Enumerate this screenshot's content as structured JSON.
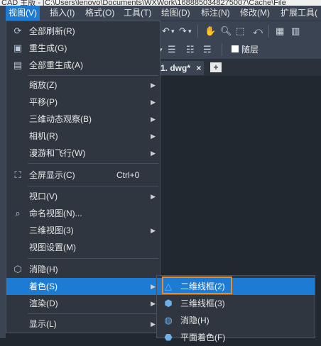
{
  "titlebar": {
    "path": "CAD 主版 - [C:\\Users\\lenovo\\Documents\\WXWork\\1688850348275007\\Cache\\File"
  },
  "menubar": {
    "items": [
      {
        "label": "视图(V)",
        "active": true
      },
      {
        "label": "插入(I)"
      },
      {
        "label": "格式(O)"
      },
      {
        "label": "工具(T)"
      },
      {
        "label": "绘图(D)"
      },
      {
        "label": "标注(N)"
      },
      {
        "label": "修改(M)"
      },
      {
        "label": "扩展工具("
      }
    ]
  },
  "toolbar": {
    "layer_label": "随层"
  },
  "doc_tab": {
    "label": "1. dwg*",
    "close": "×"
  },
  "view_menu": {
    "items": [
      {
        "label": "全部刷新(R)",
        "icon": "refresh-icon"
      },
      {
        "label": "重生成(G)",
        "icon": "regen-icon"
      },
      {
        "label": "全部重生成(A)",
        "icon": "regen-all-icon"
      },
      {
        "label": "缩放(Z)",
        "submenu": true
      },
      {
        "label": "平移(P)",
        "submenu": true
      },
      {
        "label": "三维动态观察(B)",
        "submenu": true
      },
      {
        "label": "相机(R)",
        "submenu": true
      },
      {
        "label": "漫游和飞行(W)",
        "submenu": true
      },
      {
        "label": "全屏显示(C)",
        "icon": "fullscreen-icon",
        "shortcut": "Ctrl+0"
      },
      {
        "label": "视口(V)",
        "submenu": true
      },
      {
        "label": "命名视图(N)...",
        "icon": "named-view-icon"
      },
      {
        "label": "三维视图(3)",
        "submenu": true
      },
      {
        "label": "视图设置(M)"
      },
      {
        "label": "消隐(H)",
        "icon": "hide-icon"
      },
      {
        "label": "着色(S)",
        "submenu": true,
        "highlighted": true
      },
      {
        "label": "渲染(D)",
        "submenu": true
      },
      {
        "label": "显示(L)",
        "submenu": true
      }
    ]
  },
  "shade_submenu": {
    "items": [
      {
        "label": "二维线框(2)",
        "icon": "wireframe-2d-icon",
        "highlighted": true
      },
      {
        "label": "三维线框(3)",
        "icon": "wireframe-3d-icon"
      },
      {
        "label": "消隐(H)",
        "icon": "hidden-icon"
      },
      {
        "label": "平面着色(F)",
        "icon": "flat-shade-icon"
      }
    ]
  },
  "colors": {
    "accent": "#1e7bd4",
    "focus": "#f08a1c",
    "menu_bg": "#2f3640"
  }
}
